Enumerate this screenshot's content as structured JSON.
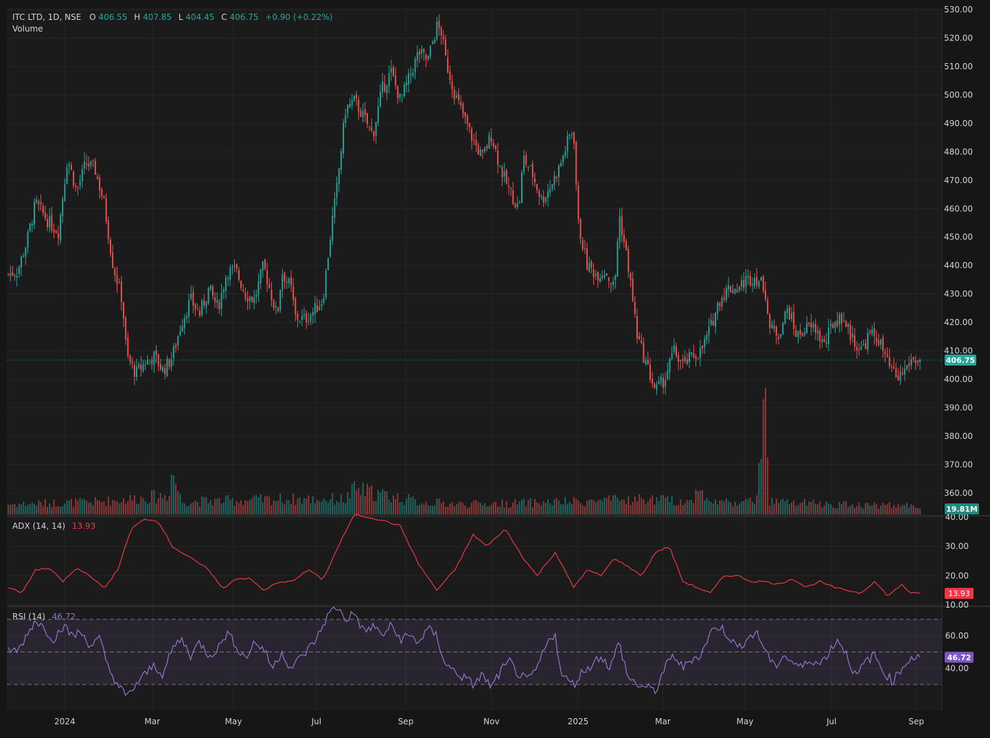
{
  "legend": {
    "symbol": "ITC LTD, 1D, NSE",
    "o_label": "O",
    "o_value": "406.55",
    "h_label": "H",
    "h_value": "407.85",
    "l_label": "L",
    "l_value": "404.45",
    "c_label": "C",
    "c_value": "406.75",
    "change": "+0.90 (+0.22%)",
    "volume_label": "Volume"
  },
  "tags": {
    "last_price": "406.75",
    "volume": "19.81M",
    "adx": "13.93",
    "rsi": "46.72"
  },
  "colors": {
    "up": "#26a69a",
    "down": "#ef5350",
    "adx": "#f23645",
    "rsi": "#9575cd",
    "background": "#161616",
    "grid": "#262626",
    "text": "#d1d4dc"
  },
  "chart_data": [
    {
      "type": "candlestick",
      "name": "ITC LTD, 1D, NSE",
      "x_ticks": [
        "2024",
        "Mar",
        "May",
        "Jul",
        "Sep",
        "Nov",
        "2025",
        "Mar",
        "May",
        "Jul",
        "Sep"
      ],
      "y_ticks": [
        "530.00",
        "520.00",
        "510.00",
        "500.00",
        "490.00",
        "480.00",
        "470.00",
        "460.00",
        "450.00",
        "440.00",
        "430.00",
        "420.00",
        "410.00",
        "400.00",
        "390.00",
        "380.00",
        "370.00",
        "360.00"
      ],
      "ylim": [
        352.5,
        530
      ],
      "xlim": [
        0,
        1
      ],
      "last": 406.75,
      "grid": true,
      "price_path": [
        [
          0.0,
          437
        ],
        [
          0.01,
          438
        ],
        [
          0.02,
          448
        ],
        [
          0.03,
          462
        ],
        [
          0.045,
          455
        ],
        [
          0.055,
          452
        ],
        [
          0.065,
          478
        ],
        [
          0.075,
          466
        ],
        [
          0.085,
          476
        ],
        [
          0.095,
          474
        ],
        [
          0.105,
          462
        ],
        [
          0.115,
          440
        ],
        [
          0.125,
          428
        ],
        [
          0.13,
          408
        ],
        [
          0.14,
          402
        ],
        [
          0.15,
          406
        ],
        [
          0.16,
          408
        ],
        [
          0.17,
          403
        ],
        [
          0.18,
          408
        ],
        [
          0.19,
          420
        ],
        [
          0.2,
          428
        ],
        [
          0.21,
          423
        ],
        [
          0.22,
          432
        ],
        [
          0.23,
          425
        ],
        [
          0.24,
          438
        ],
        [
          0.25,
          438
        ],
        [
          0.26,
          430
        ],
        [
          0.27,
          428
        ],
        [
          0.28,
          440
        ],
        [
          0.29,
          428
        ],
        [
          0.295,
          422
        ],
        [
          0.3,
          438
        ],
        [
          0.31,
          432
        ],
        [
          0.315,
          422
        ],
        [
          0.325,
          421
        ],
        [
          0.335,
          424
        ],
        [
          0.345,
          428
        ],
        [
          0.355,
          455
        ],
        [
          0.36,
          466
        ],
        [
          0.37,
          495
        ],
        [
          0.38,
          498
        ],
        [
          0.39,
          492
        ],
        [
          0.4,
          486
        ],
        [
          0.41,
          502
        ],
        [
          0.42,
          508
        ],
        [
          0.43,
          498
        ],
        [
          0.44,
          506
        ],
        [
          0.45,
          515
        ],
        [
          0.46,
          512
        ],
        [
          0.47,
          524
        ],
        [
          0.475,
          522
        ],
        [
          0.48,
          512
        ],
        [
          0.49,
          500
        ],
        [
          0.5,
          492
        ],
        [
          0.51,
          484
        ],
        [
          0.52,
          478
        ],
        [
          0.53,
          486
        ],
        [
          0.54,
          474
        ],
        [
          0.55,
          466
        ],
        [
          0.56,
          460
        ],
        [
          0.565,
          478
        ],
        [
          0.575,
          472
        ],
        [
          0.585,
          463
        ],
        [
          0.595,
          468
        ],
        [
          0.605,
          475
        ],
        [
          0.615,
          485
        ],
        [
          0.62,
          488
        ],
        [
          0.625,
          455
        ],
        [
          0.635,
          440
        ],
        [
          0.645,
          437
        ],
        [
          0.655,
          438
        ],
        [
          0.665,
          432
        ],
        [
          0.67,
          458
        ],
        [
          0.68,
          440
        ],
        [
          0.69,
          415
        ],
        [
          0.7,
          405
        ],
        [
          0.71,
          396
        ],
        [
          0.72,
          400
        ],
        [
          0.73,
          410
        ],
        [
          0.74,
          405
        ],
        [
          0.75,
          408
        ],
        [
          0.76,
          410
        ],
        [
          0.77,
          418
        ],
        [
          0.78,
          428
        ],
        [
          0.79,
          432
        ],
        [
          0.8,
          432
        ],
        [
          0.81,
          435
        ],
        [
          0.82,
          436
        ],
        [
          0.83,
          432
        ],
        [
          0.835,
          418
        ],
        [
          0.845,
          416
        ],
        [
          0.855,
          425
        ],
        [
          0.865,
          415
        ],
        [
          0.875,
          418
        ],
        [
          0.885,
          418
        ],
        [
          0.895,
          412
        ],
        [
          0.905,
          420
        ],
        [
          0.915,
          422
        ],
        [
          0.925,
          415
        ],
        [
          0.935,
          410
        ],
        [
          0.945,
          416
        ],
        [
          0.955,
          414
        ],
        [
          0.965,
          405
        ],
        [
          0.975,
          400
        ],
        [
          0.985,
          404
        ],
        [
          0.99,
          406.75
        ]
      ]
    },
    {
      "type": "bar",
      "name": "Volume",
      "last": "19.81M",
      "volume_path": [
        [
          0.0,
          0.08
        ],
        [
          0.1,
          0.1
        ],
        [
          0.175,
          0.15
        ],
        [
          0.18,
          0.35
        ],
        [
          0.19,
          0.1
        ],
        [
          0.3,
          0.12
        ],
        [
          0.37,
          0.12
        ],
        [
          0.38,
          0.2
        ],
        [
          0.45,
          0.1
        ],
        [
          0.5,
          0.08
        ],
        [
          0.62,
          0.1
        ],
        [
          0.7,
          0.12
        ],
        [
          0.75,
          0.1
        ],
        [
          0.76,
          0.28
        ],
        [
          0.765,
          0.1
        ],
        [
          0.82,
          0.1
        ],
        [
          0.83,
          1.0
        ],
        [
          0.835,
          0.1
        ],
        [
          0.9,
          0.08
        ],
        [
          0.99,
          0.07
        ]
      ]
    },
    {
      "type": "line",
      "name": "ADX (14, 14)",
      "value": "13.93",
      "y_ticks": [
        "40.00",
        "30.00",
        "20.00",
        "10.00"
      ],
      "ylim": [
        9.5,
        40.5
      ],
      "series_path": [
        [
          0.0,
          16
        ],
        [
          0.015,
          14
        ],
        [
          0.03,
          22
        ],
        [
          0.045,
          22.5
        ],
        [
          0.06,
          18
        ],
        [
          0.075,
          22.5
        ],
        [
          0.09,
          20
        ],
        [
          0.105,
          15.5
        ],
        [
          0.12,
          22
        ],
        [
          0.135,
          36
        ],
        [
          0.15,
          39.5
        ],
        [
          0.165,
          38.5
        ],
        [
          0.18,
          30
        ],
        [
          0.2,
          26
        ],
        [
          0.22,
          22
        ],
        [
          0.235,
          15.5
        ],
        [
          0.25,
          19
        ],
        [
          0.265,
          19
        ],
        [
          0.28,
          15
        ],
        [
          0.295,
          17.5
        ],
        [
          0.31,
          18
        ],
        [
          0.33,
          22
        ],
        [
          0.345,
          18.5
        ],
        [
          0.365,
          32
        ],
        [
          0.38,
          41
        ],
        [
          0.395,
          40
        ],
        [
          0.41,
          39
        ],
        [
          0.43,
          37
        ],
        [
          0.45,
          24
        ],
        [
          0.47,
          15
        ],
        [
          0.49,
          22
        ],
        [
          0.51,
          34
        ],
        [
          0.525,
          30
        ],
        [
          0.545,
          36
        ],
        [
          0.565,
          26
        ],
        [
          0.58,
          20
        ],
        [
          0.6,
          28
        ],
        [
          0.62,
          16
        ],
        [
          0.635,
          22
        ],
        [
          0.65,
          20
        ],
        [
          0.665,
          26
        ],
        [
          0.68,
          23
        ],
        [
          0.695,
          20
        ],
        [
          0.71,
          28
        ],
        [
          0.725,
          30
        ],
        [
          0.74,
          18
        ],
        [
          0.755,
          16
        ],
        [
          0.77,
          14
        ],
        [
          0.785,
          20
        ],
        [
          0.8,
          20
        ],
        [
          0.815,
          18
        ],
        [
          0.83,
          18
        ],
        [
          0.845,
          17
        ],
        [
          0.86,
          19
        ],
        [
          0.875,
          16
        ],
        [
          0.89,
          18
        ],
        [
          0.905,
          16
        ],
        [
          0.92,
          15
        ],
        [
          0.935,
          14
        ],
        [
          0.95,
          18
        ],
        [
          0.965,
          13
        ],
        [
          0.98,
          17
        ],
        [
          0.99,
          13.93
        ]
      ]
    },
    {
      "type": "line",
      "name": "RSI (14)",
      "value": "46.72",
      "y_ticks": [
        "60.00",
        "40.00"
      ],
      "ylim": [
        14,
        78
      ],
      "band": [
        30,
        70
      ],
      "mid": 50,
      "series_path": [
        [
          0.0,
          52
        ],
        [
          0.01,
          50
        ],
        [
          0.02,
          60
        ],
        [
          0.03,
          70
        ],
        [
          0.04,
          64
        ],
        [
          0.05,
          58
        ],
        [
          0.06,
          66
        ],
        [
          0.07,
          60
        ],
        [
          0.08,
          62
        ],
        [
          0.09,
          54
        ],
        [
          0.1,
          58
        ],
        [
          0.11,
          40
        ],
        [
          0.12,
          30
        ],
        [
          0.13,
          22
        ],
        [
          0.14,
          30
        ],
        [
          0.15,
          36
        ],
        [
          0.16,
          42
        ],
        [
          0.17,
          36
        ],
        [
          0.18,
          52
        ],
        [
          0.19,
          58
        ],
        [
          0.2,
          48
        ],
        [
          0.21,
          56
        ],
        [
          0.22,
          48
        ],
        [
          0.23,
          52
        ],
        [
          0.24,
          62
        ],
        [
          0.25,
          54
        ],
        [
          0.26,
          46
        ],
        [
          0.27,
          56
        ],
        [
          0.28,
          52
        ],
        [
          0.29,
          40
        ],
        [
          0.3,
          50
        ],
        [
          0.31,
          40
        ],
        [
          0.32,
          46
        ],
        [
          0.33,
          52
        ],
        [
          0.34,
          60
        ],
        [
          0.35,
          72
        ],
        [
          0.36,
          78
        ],
        [
          0.37,
          70
        ],
        [
          0.38,
          74
        ],
        [
          0.39,
          62
        ],
        [
          0.4,
          66
        ],
        [
          0.41,
          60
        ],
        [
          0.42,
          66
        ],
        [
          0.43,
          58
        ],
        [
          0.44,
          60
        ],
        [
          0.45,
          56
        ],
        [
          0.46,
          64
        ],
        [
          0.47,
          60
        ],
        [
          0.475,
          50
        ],
        [
          0.48,
          42
        ],
        [
          0.49,
          38
        ],
        [
          0.5,
          34
        ],
        [
          0.51,
          30
        ],
        [
          0.52,
          36
        ],
        [
          0.53,
          28
        ],
        [
          0.54,
          38
        ],
        [
          0.55,
          44
        ],
        [
          0.56,
          36
        ],
        [
          0.57,
          32
        ],
        [
          0.58,
          40
        ],
        [
          0.59,
          54
        ],
        [
          0.6,
          62
        ],
        [
          0.605,
          40
        ],
        [
          0.61,
          34
        ],
        [
          0.62,
          30
        ],
        [
          0.63,
          38
        ],
        [
          0.64,
          42
        ],
        [
          0.65,
          48
        ],
        [
          0.66,
          40
        ],
        [
          0.67,
          56
        ],
        [
          0.68,
          34
        ],
        [
          0.69,
          30
        ],
        [
          0.7,
          28
        ],
        [
          0.71,
          26
        ],
        [
          0.72,
          40
        ],
        [
          0.73,
          48
        ],
        [
          0.74,
          40
        ],
        [
          0.75,
          46
        ],
        [
          0.76,
          48
        ],
        [
          0.77,
          62
        ],
        [
          0.78,
          66
        ],
        [
          0.79,
          60
        ],
        [
          0.8,
          52
        ],
        [
          0.81,
          58
        ],
        [
          0.82,
          62
        ],
        [
          0.83,
          52
        ],
        [
          0.84,
          40
        ],
        [
          0.85,
          48
        ],
        [
          0.86,
          44
        ],
        [
          0.87,
          40
        ],
        [
          0.88,
          46
        ],
        [
          0.89,
          42
        ],
        [
          0.9,
          50
        ],
        [
          0.91,
          58
        ],
        [
          0.92,
          48
        ],
        [
          0.93,
          34
        ],
        [
          0.94,
          44
        ],
        [
          0.95,
          48
        ],
        [
          0.96,
          38
        ],
        [
          0.97,
          32
        ],
        [
          0.98,
          40
        ],
        [
          0.99,
          46.72
        ]
      ]
    }
  ]
}
